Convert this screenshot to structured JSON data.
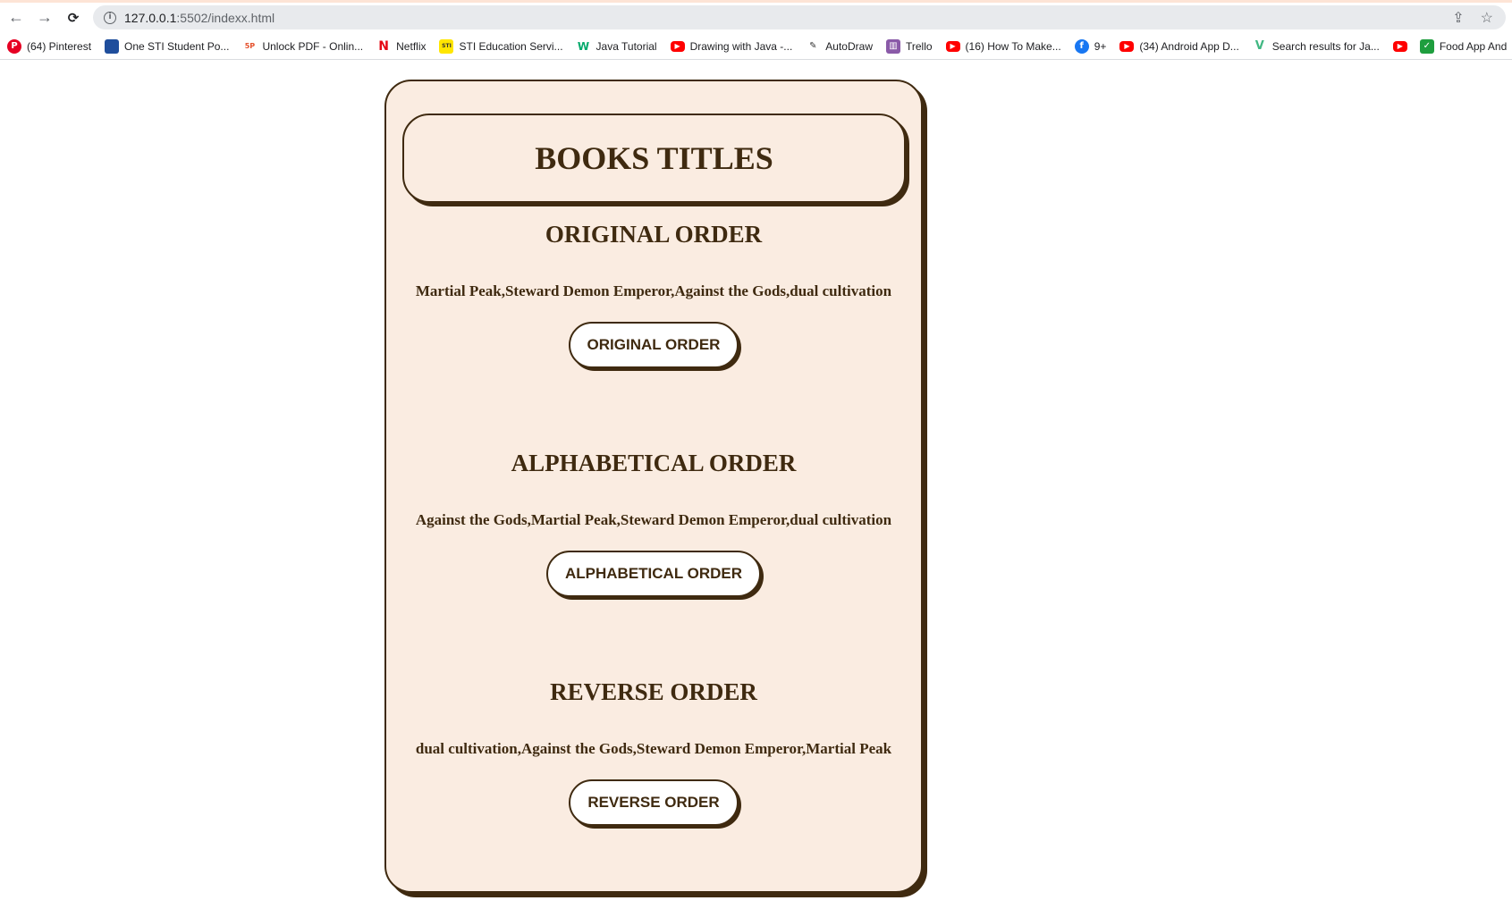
{
  "browser": {
    "url_host": "127.0.0.1",
    "url_rest": ":5502/indexx.html",
    "nav": {
      "back": "←",
      "forward": "→",
      "reload": "C"
    },
    "info_glyph": "i",
    "share_glyph": "⇪",
    "star_glyph": "☆",
    "bookmarks": [
      {
        "label": "(64) Pinterest",
        "icon": "pinterest-icon",
        "glyph": "P",
        "color": "#e60023"
      },
      {
        "label": "One STI Student Po...",
        "icon": "sti-portal-icon",
        "glyph": "",
        "color": "#1f4e9c"
      },
      {
        "label": "Unlock PDF - Onlin...",
        "icon": "smallpdf-icon",
        "glyph": "5P",
        "color": "#ffffff"
      },
      {
        "label": "Netflix",
        "icon": "netflix-icon",
        "glyph": "N",
        "color": "#ffffff"
      },
      {
        "label": "STI Education Servi...",
        "icon": "sti-education-icon",
        "glyph": "STI",
        "color": "#ffe600"
      },
      {
        "label": "Java Tutorial",
        "icon": "w3schools-icon",
        "glyph": "W",
        "color": "#ffffff"
      },
      {
        "label": "Drawing with Java -...",
        "icon": "youtube-icon",
        "glyph": "▶",
        "color": "#ff0000"
      },
      {
        "label": "AutoDraw",
        "icon": "autodraw-icon",
        "glyph": "✎",
        "color": "#ffffff"
      },
      {
        "label": "Trello",
        "icon": "trello-icon",
        "glyph": "▥",
        "color": "#8a5aa8"
      },
      {
        "label": "(16) How To Make...",
        "icon": "youtube-icon",
        "glyph": "▶",
        "color": "#ff0000"
      },
      {
        "label": "9+",
        "icon": "facebook-icon",
        "glyph": "f",
        "color": "#1877f2"
      },
      {
        "label": "(34) Android App D...",
        "icon": "youtube-icon",
        "glyph": "▶",
        "color": "#ff0000"
      },
      {
        "label": "Search results for Ja...",
        "icon": "vue-icon",
        "glyph": "V",
        "color": "#ffffff"
      },
      {
        "label": "",
        "icon": "youtube-icon",
        "glyph": "▶",
        "color": "#ff0000"
      },
      {
        "label": "Food App And",
        "icon": "checkbox-icon",
        "glyph": "✓",
        "color": "#1e9e3e"
      }
    ]
  },
  "page": {
    "title": "BOOKS TITLES",
    "sections": [
      {
        "heading": "ORIGINAL ORDER",
        "list_text": "Martial Peak,Steward Demon Emperor,Against the Gods,dual cultivation",
        "button": "ORIGINAL ORDER"
      },
      {
        "heading": "ALPHABETICAL ORDER",
        "list_text": "Against the Gods,Martial Peak,Steward Demon Emperor,dual cultivation",
        "button": "ALPHABETICAL ORDER"
      },
      {
        "heading": "REVERSE ORDER",
        "list_text": "dual cultivation,Against the Gods,Steward Demon Emperor,Martial Peak",
        "button": "REVERSE ORDER"
      }
    ]
  },
  "colors": {
    "card_bg": "#faece1",
    "ink": "#3f2a10",
    "button_bg": "#ffffff"
  }
}
